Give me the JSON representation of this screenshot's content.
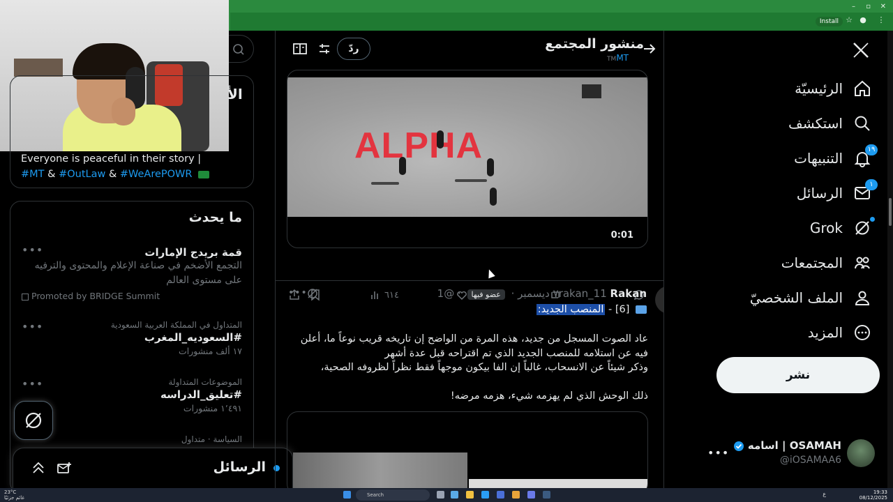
{
  "browser": {
    "install_label": "Install"
  },
  "left": {
    "card_heading_partial": "الأ",
    "bio_text": "Everyone is peaceful in their story |",
    "bio_hashtags": [
      "#MT",
      "#OutLaw",
      "#WeArePOWR"
    ],
    "bio_sep": "&",
    "trends_title": "ما يحدث",
    "trend1_name": "قمة بريدج الإمارات",
    "trend1_desc": "التجمع الأضخم في صناعة الإعلام والمحتوى والترفيه على مستوى العالم",
    "trend1_promoted": "Promoted by BRIDGE Summit",
    "trend2_ctx": "المتداول في المملكة العربية السعودية",
    "trend2_name": "#السعوديه_المغرب",
    "trend2_count": "١٧ ألف منشورات",
    "trend3_ctx": "الموضوعات المتداولة",
    "trend3_name": "#تعليق_الدراسه",
    "trend3_count": "١٬٤٩١ منشورات",
    "trend4_ctx": "السياسة · متداول",
    "messages_title": "الرسائل"
  },
  "center": {
    "page_title": "منشور المجتمع",
    "community_tag": "MT",
    "tm": "TM",
    "reply_label": "ردّ",
    "video_overlay_text": "ALPHA",
    "video_time": "0:01",
    "actions": {
      "replies": "١",
      "likes": "٢٢",
      "views": "٦١٤"
    },
    "post2": {
      "display_name": "Rakan",
      "handle": "@1rakan_11",
      "member_badge": "عضو فيها",
      "date": "٧ ديسمبر",
      "subtitle_num": "[6] -",
      "subtitle_hl": "المنصب الجديد:",
      "body_line1": "عاد الصوت المسجل من جديد، هذه المرة من الواضح إن تاريخه قريب نوعاً ما، أعلن فيه عن استلامه للمنصب الجديد الذي تم اقتراحه قبل عدة أشهر",
      "body_line2": "وذكر شيئاً عن الانسحاب، غالباً إن الفا بيكون موجهاً فقط نظراً لظروفه الصحية،",
      "body_line3": "ذلك الوحش الذي لم يهزمه شيء، هزمه مرضه!"
    }
  },
  "nav": {
    "home": "الرئيسيّة",
    "explore": "استكشف",
    "notifications": "التنبيهات",
    "notifications_count": "١٩",
    "messages": "الرسائل",
    "messages_count": "١",
    "grok": "Grok",
    "communities": "المجتمعات",
    "profile": "الملف الشخصيّ",
    "more": "المزيد",
    "post_button": "نشر",
    "account_name": "اسامه | OSAMAH",
    "account_handle": "@iOSAMAA6"
  },
  "taskbar": {
    "weather_temp": "23°C",
    "weather_desc": "غائم جزئيًا",
    "search_label": "Search",
    "time": "19:33",
    "date": "08/12/2025",
    "lang": "ع"
  },
  "colors": {
    "accent": "#1d9bf0",
    "background": "#000000",
    "browser_bar": "#2b8a3e",
    "alpha_red": "#e3343f",
    "highlight": "#1d4fa8"
  }
}
